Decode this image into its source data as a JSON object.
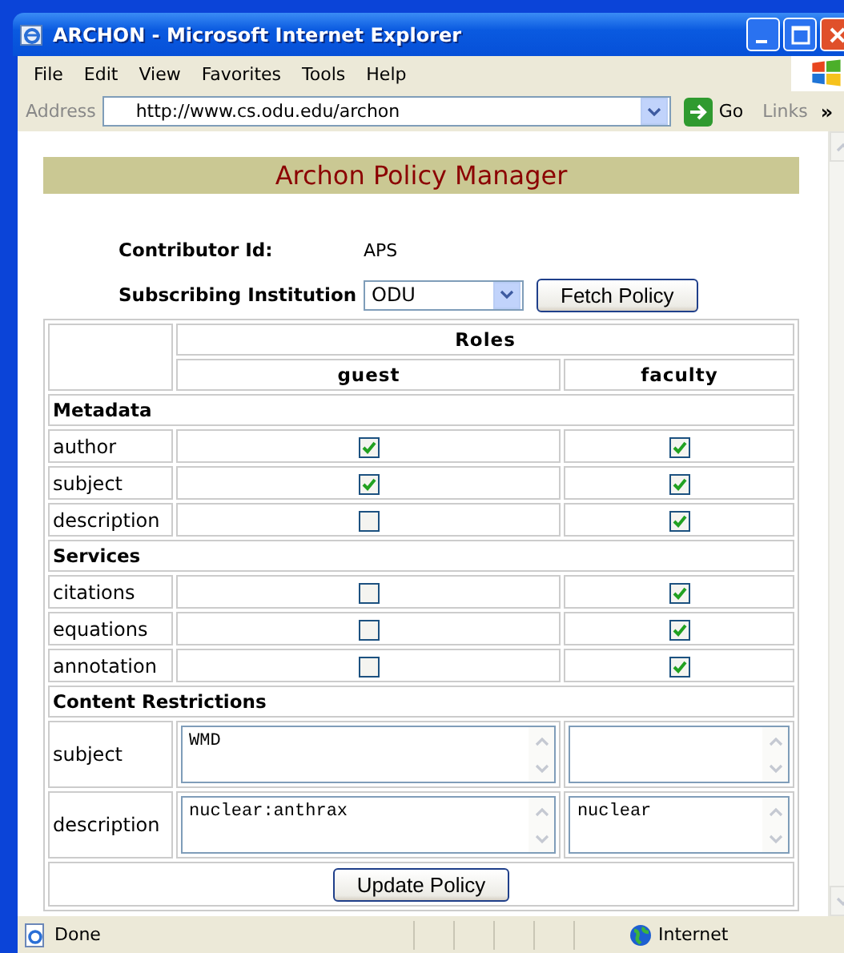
{
  "window": {
    "title": "ARCHON - Microsoft Internet Explorer"
  },
  "menu": [
    "File",
    "Edit",
    "View",
    "Favorites",
    "Tools",
    "Help"
  ],
  "address_bar": {
    "label": "Address",
    "value": "http://www.cs.odu.edu/archon",
    "go": "Go",
    "links": "Links",
    "more": "»"
  },
  "page": {
    "heading": "Archon Policy Manager",
    "contributor": {
      "label": "Contributor Id:",
      "value": "APS"
    },
    "institution": {
      "label": "Subscribing Institution",
      "value": "ODU"
    },
    "fetch_button": "Fetch Policy",
    "table": {
      "roles_heading": "Roles",
      "roles": [
        "guest",
        "faculty"
      ],
      "sections": [
        {
          "title": "Metadata",
          "kind": "checkboxes",
          "rows": [
            {
              "label": "author",
              "cells": [
                {
                  "checked": true
                },
                {
                  "checked": true
                }
              ]
            },
            {
              "label": "subject",
              "cells": [
                {
                  "checked": true
                },
                {
                  "checked": true
                }
              ]
            },
            {
              "label": "description",
              "cells": [
                {
                  "checked": false
                },
                {
                  "checked": true
                }
              ]
            }
          ]
        },
        {
          "title": "Services",
          "kind": "checkboxes",
          "rows": [
            {
              "label": "citations",
              "cells": [
                {
                  "checked": false
                },
                {
                  "checked": true
                }
              ]
            },
            {
              "label": "equations",
              "cells": [
                {
                  "checked": false
                },
                {
                  "checked": true
                }
              ]
            },
            {
              "label": "annotation",
              "cells": [
                {
                  "checked": false
                },
                {
                  "checked": true
                }
              ]
            }
          ]
        },
        {
          "title": "Content Restrictions",
          "kind": "textareas",
          "rows": [
            {
              "label": "subject",
              "cells": [
                {
                  "value": "WMD"
                },
                {}
              ]
            },
            {
              "label": "description",
              "cells": [
                {
                  "value": "nuclear:anthrax"
                },
                {
                  "value": "nuclear"
                }
              ]
            }
          ]
        }
      ]
    },
    "update_button": "Update Policy"
  },
  "status_bar": {
    "text": "Done",
    "zone": "Internet"
  }
}
